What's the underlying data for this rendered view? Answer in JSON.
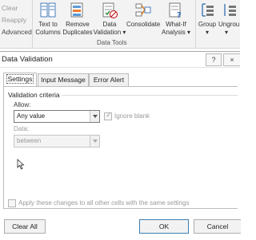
{
  "ribbon": {
    "left_items": [
      "Clear",
      "Reapply",
      "Advanced"
    ],
    "buttons": [
      {
        "line1": "Text to",
        "line2": "Columns"
      },
      {
        "line1": "Remove",
        "line2": "Duplicates"
      },
      {
        "line1": "Data",
        "line2": "Validation ▾"
      },
      {
        "line1": "Consolidate",
        "line2": ""
      },
      {
        "line1": "What-If",
        "line2": "Analysis ▾"
      },
      {
        "line1": "Group",
        "line2": "▾"
      },
      {
        "line1": "Ungrou",
        "line2": "▾"
      }
    ],
    "group_label": "Data Tools"
  },
  "dialog": {
    "title": "Data Validation",
    "help_label": "?",
    "close_label": "×",
    "tabs": [
      "Settings",
      "Input Message",
      "Error Alert"
    ],
    "active_tab": "Settings",
    "section_label": "Validation criteria",
    "allow_label": "Allow:",
    "allow_value": "Any value",
    "ignore_blank_label": "Ignore blank",
    "ignore_blank_checked": true,
    "data_label": "Data:",
    "data_value": "between",
    "apply_label": "Apply these changes to all other cells with the same settings",
    "clear_all_label": "Clear All",
    "ok_label": "OK",
    "cancel_label": "Cancel"
  }
}
